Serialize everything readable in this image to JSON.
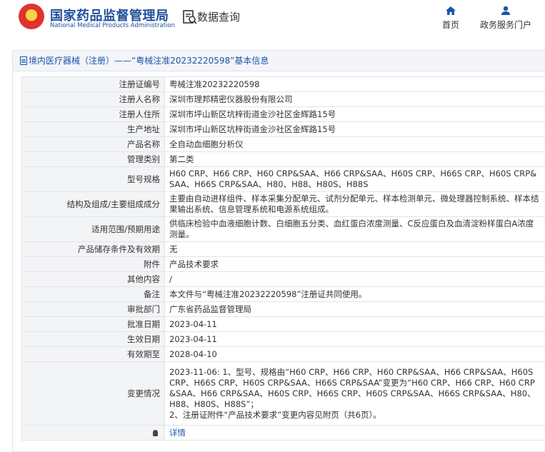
{
  "header": {
    "logo_cn": "国家药品监督管理局",
    "logo_en": "National Medical Products Administration",
    "query_label": "数据查询",
    "nav": {
      "home": "首页",
      "service": "政务服务门户"
    }
  },
  "panel": {
    "title": "境内医疗器械（注册）——“粤械注准20232220598”基本信息"
  },
  "rows": [
    {
      "label": "注册证编号",
      "value": "粤械注准20232220598"
    },
    {
      "label": "注册人名称",
      "value": "深圳市理邦精密仪器股份有限公司"
    },
    {
      "label": "注册人住所",
      "value": "深圳市坪山新区坑梓街道金沙社区金辉路15号"
    },
    {
      "label": "生产地址",
      "value": "深圳市坪山新区坑梓街道金沙社区金辉路15号"
    },
    {
      "label": "产品名称",
      "value": "全自动血细胞分析仪"
    },
    {
      "label": "管理类别",
      "value": "第二类"
    },
    {
      "label": "型号规格",
      "value": "H60 CRP、H66 CRP、H60 CRP&SAA、H66 CRP&SAA、H60S CRP、H66S CRP、H60S CRP&SAA、H66S CRP&SAA、H80、H88、H80S、H88S"
    },
    {
      "label": "结构及组成/主要组成成分",
      "value": "主要由自动进样组件、样本采集分配单元、试剂分配单元、样本检测单元、微处理器控制系统、样本结果输出系统、信息管理系统和电源系统组成。"
    },
    {
      "label": "适用范围/预期用途",
      "value": "供临床检验中血液细胞计数、白细胞五分类、血红蛋白浓度测量、C反应蛋白及血清淀粉样蛋白A浓度测量。"
    },
    {
      "label": "产品储存条件及有效期",
      "value": "无"
    },
    {
      "label": "附件",
      "value": "产品技术要求"
    },
    {
      "label": "其他内容",
      "value": "/"
    },
    {
      "label": "备注",
      "value": "本文件与“粤械注准20232220598”注册证共同使用。"
    },
    {
      "label": "审批部门",
      "value": "广东省药品监督管理局"
    },
    {
      "label": "批准日期",
      "value": "2023-04-11"
    },
    {
      "label": "生效日期",
      "value": "2023-04-11"
    },
    {
      "label": "有效期至",
      "value": "2028-04-10"
    }
  ],
  "change": {
    "label": "变更情况",
    "line1": "2023-11-06: 1、型号、规格由“H60 CRP、H66 CRP、H60 CRP&SAA、H66 CRP&SAA、H60S CRP、H66S CRP、H60S CRP&SAA、H66S CRP&SAA”变更为“H60 CRP、H66 CRP、H60 CRP&SAA、H66 CRP&SAA、H60S CRP、H66S CRP、H60S CRP&SAA、H66S CRP&SAA、H80、H88、H80S、H88S”；",
    "line2": "2、注册证附件“产品技术要求”变更内容见附页（共6页）。"
  },
  "footer_row": {
    "link": "详情"
  }
}
